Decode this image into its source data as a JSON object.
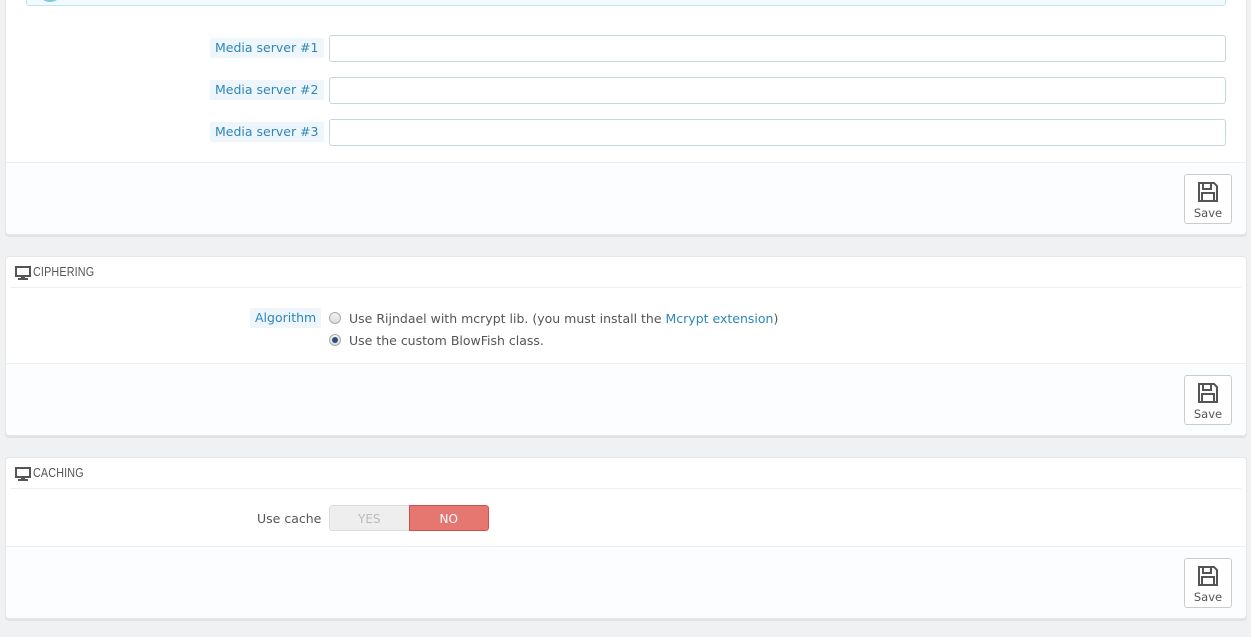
{
  "media_servers": {
    "fields": [
      {
        "label": "Media server #1",
        "value": "",
        "placeholder": ""
      },
      {
        "label": "Media server #2",
        "value": "",
        "placeholder": ""
      },
      {
        "label": "Media server #3",
        "value": "",
        "placeholder": ""
      }
    ],
    "save_label": "Save"
  },
  "ciphering": {
    "title": "CIPHERING",
    "algorithm_label": "Algorithm",
    "options": [
      {
        "text_before": "Use Rijndael with mcrypt lib. (you must install the ",
        "link_text": "Mcrypt extension",
        "text_after": ")",
        "checked": false
      },
      {
        "text_before": "Use the custom BlowFish class.",
        "link_text": "",
        "text_after": "",
        "checked": true
      }
    ],
    "save_label": "Save"
  },
  "caching": {
    "title": "CACHING",
    "use_cache_label": "Use cache",
    "yes_label": "YES",
    "no_label": "NO",
    "selected": "NO",
    "save_label": "Save"
  },
  "icons": {
    "info": "info-circle-icon",
    "save": "floppy-disk-icon",
    "heading": "desktop-monitor-icon"
  },
  "colors": {
    "link": "#2d87b9",
    "toggle_no": "#e67670",
    "info_bg": "#f1fafd"
  }
}
